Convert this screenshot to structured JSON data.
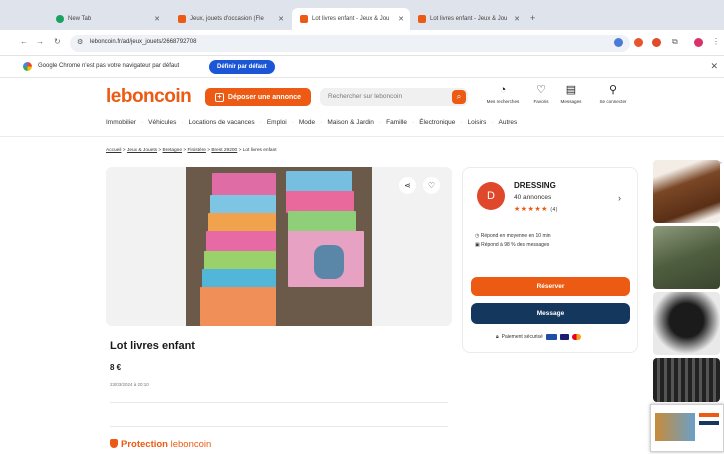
{
  "browser": {
    "tabs": [
      {
        "label": "New Tab",
        "active": false
      },
      {
        "label": "Jeux, jouets d'occasion (Fle",
        "active": false
      },
      {
        "label": "Lot livres enfant - Jeux & Jou",
        "active": true
      },
      {
        "label": "Lot livres enfant - Jeux & Jou",
        "active": false
      }
    ],
    "url": "leboncoin.fr/ad/jeux_jouets/2668792708"
  },
  "infobar": {
    "message": "Google Chrome n'est pas votre navigateur par défaut",
    "button": "Définir par défaut"
  },
  "header": {
    "logo": "leboncoin",
    "post_button": "Déposer une annonce",
    "search_placeholder": "Rechercher sur leboncoin",
    "icons": [
      {
        "label": "Mes recherches",
        "icon": "bell-icon"
      },
      {
        "label": "Favoris",
        "icon": "heart-icon"
      },
      {
        "label": "Messages",
        "icon": "message-icon"
      },
      {
        "label": "Se connecter",
        "icon": "user-icon"
      }
    ],
    "categories": [
      "Immobilier",
      "Véhicules",
      "Locations de vacances",
      "Emploi",
      "Mode",
      "Maison & Jardin",
      "Famille",
      "Électronique",
      "Loisirs",
      "Autres"
    ]
  },
  "breadcrumb": [
    "Accueil",
    "Jeux & Jouets",
    "Bretagne",
    "Finistère",
    "Brest 29200",
    "Lot livres enfant"
  ],
  "ad": {
    "title": "Lot livres enfant",
    "price": "8 €",
    "date": "23/03/2024 à 20:10",
    "protection_prefix": "Protection",
    "protection_brand": "leboncoin"
  },
  "seller": {
    "initial": "D",
    "name": "DRESSING",
    "count": "40 annonces",
    "stars": "★★★★★",
    "rating_count": "(4)",
    "response_line_1": "Répond en moyenne en 10 min",
    "response_line_2": "Répond à 98 % des messages",
    "reserve_button": "Réserver",
    "message_button": "Message",
    "secure_payment": "Paiement sécurisé"
  },
  "colors": {
    "brand_orange": "#ec5a13",
    "navy": "#14375d",
    "chrome_blue": "#1a56d6"
  }
}
